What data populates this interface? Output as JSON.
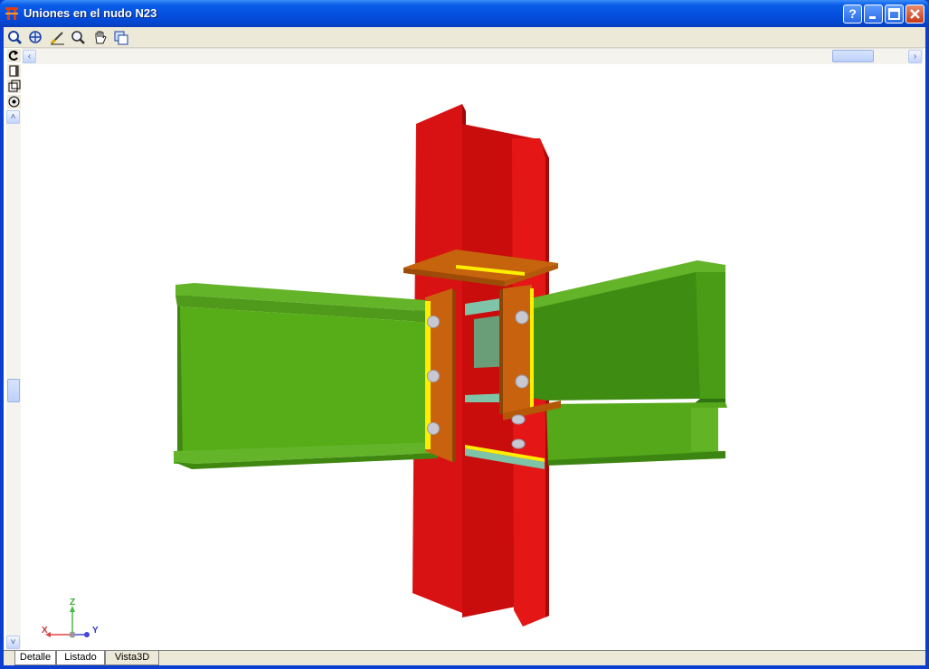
{
  "window": {
    "title": "Uniones en el nudo N23",
    "buttons": {
      "help": "?",
      "minimize": "_",
      "maximize": "□",
      "close": "✕"
    }
  },
  "toolbar": {
    "tools": [
      "select-icon",
      "zoom-extents-icon",
      "measure-icon",
      "zoom-icon",
      "pan-icon",
      "copy-view-icon"
    ],
    "vertical_tools": [
      "rotate-icon",
      "view-side-icon",
      "view-front-icon",
      "view-3d-icon"
    ]
  },
  "axes": {
    "z": "Z",
    "x": "X",
    "y": "Y"
  },
  "tabs": [
    "Detalle",
    "Listado",
    "Vista3D"
  ],
  "active_tab": "Vista3D",
  "colors": {
    "column": "#dd1010",
    "beam": "#52a814",
    "plate": "#c86410",
    "weld": "#ffee00",
    "stiffener": "#6fb7a0",
    "bolt": "#c8c8d0"
  }
}
